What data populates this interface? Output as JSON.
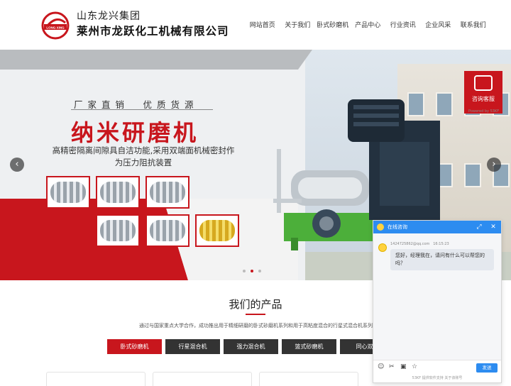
{
  "header": {
    "group_name": "山东龙兴集团",
    "company_name": "莱州市龙跃化工机械有限公司",
    "logo_text": "LONG XING",
    "nav": [
      "网站首页",
      "关于我们",
      "卧式砂磨机",
      "产品中心",
      "行业资讯",
      "企业风采",
      "联系我们"
    ]
  },
  "banner": {
    "slogan": "厂家直销　优质货源",
    "title": "纳米研磨机",
    "description": "高精密隔离间隙具自洁功能,采用双端面机械密封作为压力阻抗装置",
    "prev_label": "‹",
    "next_label": "›",
    "active_slide": 2,
    "slide_count": 3
  },
  "consult": {
    "label": "咨询客服",
    "powered": "Powered by 53KF"
  },
  "products": {
    "title": "我们的产品",
    "description": "通过与国家重点大学合作，成功推出用于精细研磨的卧式砂磨机系列和用于高粘度混合的行星式混合机系列",
    "tabs": [
      "卧式砂磨机",
      "行星混合机",
      "强力混合机",
      "篮式砂磨机",
      "同心双轴"
    ]
  },
  "chat": {
    "title": "在线咨询",
    "sender": "1424725862@qq.com",
    "time": "16:15:23",
    "message": "您好，经理我在，请问有什么可以帮您的吗？",
    "send_label": "发送",
    "footer": "53KF 提供软件支持  关于该账号"
  },
  "colors": {
    "brand_red": "#c8161d",
    "chat_blue": "#2d8cf0",
    "tab_dark": "#333333"
  }
}
